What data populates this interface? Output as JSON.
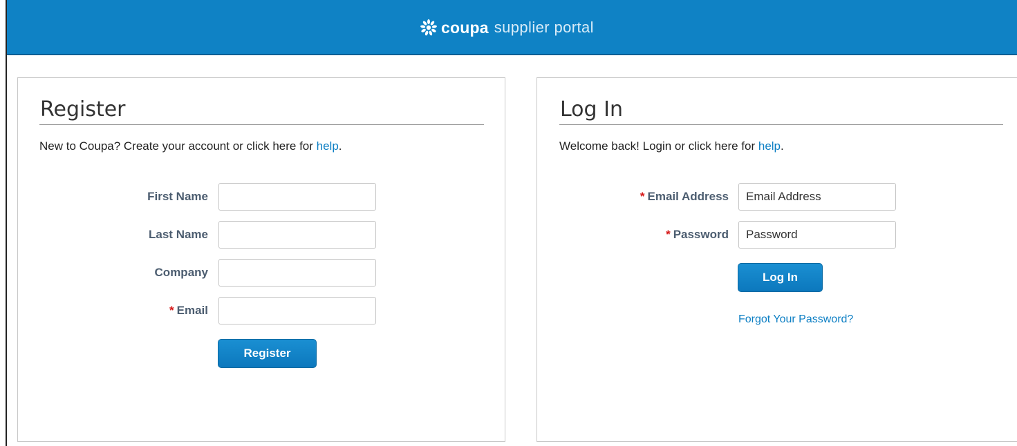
{
  "header": {
    "logo_bold": "coupa",
    "logo_light": "supplier portal",
    "brand_color": "#0f82c5"
  },
  "register": {
    "title": "Register",
    "intro_text": "New to Coupa? Create your account or click here for ",
    "help_link": "help",
    "intro_suffix": ".",
    "fields": {
      "first_name": {
        "label": "First Name",
        "value": "",
        "placeholder": ""
      },
      "last_name": {
        "label": "Last Name",
        "value": "",
        "placeholder": ""
      },
      "company": {
        "label": "Company",
        "value": "",
        "placeholder": ""
      },
      "email": {
        "label": "Email",
        "required_mark": "*",
        "value": "",
        "placeholder": ""
      }
    },
    "button_label": "Register"
  },
  "login": {
    "title": "Log In",
    "intro_text": "Welcome back! Login or click here for ",
    "help_link": "help",
    "intro_suffix": ".",
    "fields": {
      "email": {
        "label": "Email Address",
        "required_mark": "*",
        "value": "",
        "placeholder": "Email Address"
      },
      "password": {
        "label": "Password",
        "required_mark": "*",
        "value": "",
        "placeholder": "Password"
      }
    },
    "button_label": "Log In",
    "forgot_link": "Forgot Your Password?"
  },
  "colors": {
    "link": "#0d7fc4",
    "required": "#d61a1a",
    "label": "#4c5d70",
    "button": "#0c78bd"
  }
}
